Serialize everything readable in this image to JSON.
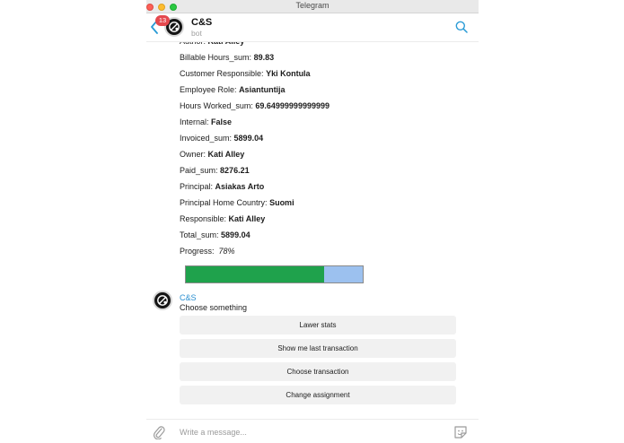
{
  "window": {
    "title": "Telegram"
  },
  "header": {
    "unread_count": "13",
    "peer_name": "C&S",
    "peer_status": "bot"
  },
  "fields": [
    {
      "label": "Author:",
      "value": "Kati Alley"
    },
    {
      "label": "Billable Hours_sum:",
      "value": "89.83"
    },
    {
      "label": "Customer Responsible:",
      "value": "Yki Kontula"
    },
    {
      "label": "Employee Role:",
      "value": "Asiantuntija"
    },
    {
      "label": "Hours Worked_sum:",
      "value": "69.64999999999999"
    },
    {
      "label": "Internal:",
      "value": "False"
    },
    {
      "label": "Invoiced_sum:",
      "value": "5899.04"
    },
    {
      "label": "Owner:",
      "value": "Kati Alley"
    },
    {
      "label": "Paid_sum:",
      "value": "8276.21"
    },
    {
      "label": "Principal:",
      "value": "Asiakas Arto"
    },
    {
      "label": "Principal Home Country:",
      "value": "Suomi"
    },
    {
      "label": "Responsible:",
      "value": "Kati Alley"
    },
    {
      "label": "Total_sum:",
      "value": "5899.04"
    }
  ],
  "progress": {
    "label": "Progress:",
    "value_text": "78%",
    "fraction": 0.78
  },
  "message": {
    "sender": "C&S",
    "text": "Choose something"
  },
  "keyboard": [
    "Lawer stats",
    "Show me last transaction",
    "Choose transaction",
    "Change assignment"
  ],
  "composer": {
    "placeholder": "Write a message..."
  },
  "colors": {
    "accent": "#2a9bd6",
    "progress_fill": "#1fa24c",
    "progress_track": "#9cc1ef",
    "badge": "#e5484d"
  },
  "icons": {
    "back": "chevron-left-icon",
    "search": "search-icon",
    "attach": "paperclip-icon",
    "sticker": "sticker-icon"
  }
}
